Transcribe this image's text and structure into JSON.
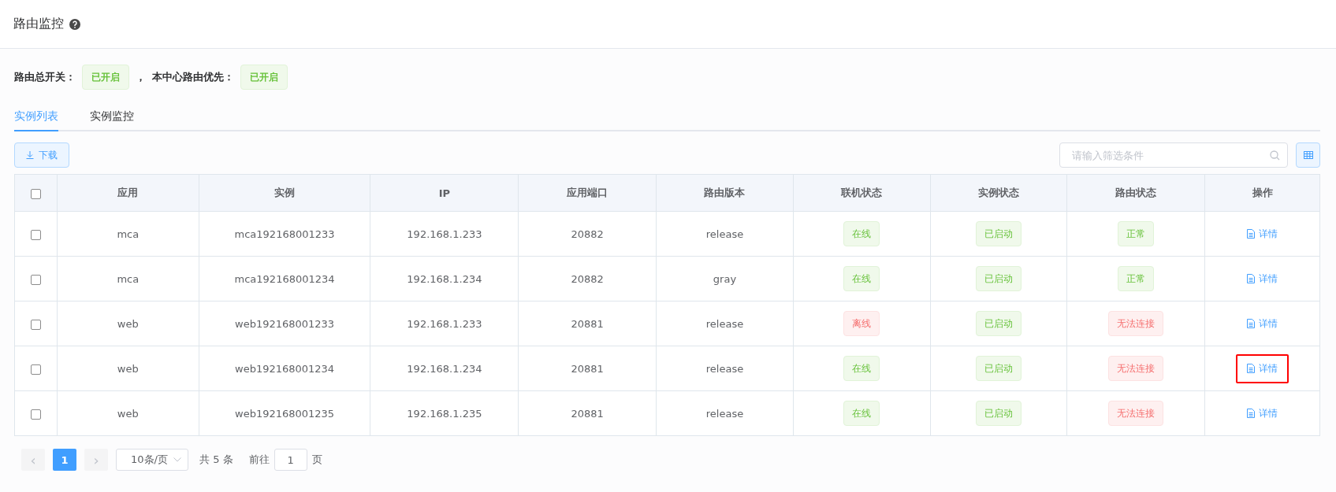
{
  "page": {
    "title": "路由监控"
  },
  "switches": [
    {
      "label": "路由总开关：",
      "value": "已开启",
      "on": true
    },
    {
      "separator": "，",
      "label": "本中心路由优先：",
      "value": "已开启",
      "on": true
    }
  ],
  "tabs": [
    {
      "label": "实例列表",
      "selected": true
    },
    {
      "label": "实例监控",
      "selected": false
    }
  ],
  "toolbar": {
    "download": "下载",
    "search": {
      "placeholder": "请输入筛选条件"
    }
  },
  "table": {
    "select_all": {
      "checked": false
    },
    "columns": [
      "应用",
      "实例",
      "IP",
      "应用端口",
      "路由版本",
      "联机状态",
      "实例状态",
      "路由状态",
      "操作"
    ],
    "rows": [
      {
        "checked": false,
        "cells": [
          "mca",
          "mca192168001233",
          "192.168.1.233",
          "20882",
          "release"
        ],
        "tags": [
          {
            "text": "在线",
            "kind": "success"
          },
          {
            "text": "已启动",
            "kind": "success"
          },
          {
            "text": "正常",
            "kind": "success"
          }
        ],
        "action": "详情",
        "highlighted": false
      },
      {
        "checked": false,
        "cells": [
          "mca",
          "mca192168001234",
          "192.168.1.234",
          "20882",
          "gray"
        ],
        "tags": [
          {
            "text": "在线",
            "kind": "success"
          },
          {
            "text": "已启动",
            "kind": "success"
          },
          {
            "text": "正常",
            "kind": "success"
          }
        ],
        "action": "详情",
        "highlighted": false
      },
      {
        "checked": false,
        "cells": [
          "web",
          "web192168001233",
          "192.168.1.233",
          "20881",
          "release"
        ],
        "tags": [
          {
            "text": "离线",
            "kind": "danger"
          },
          {
            "text": "已启动",
            "kind": "success"
          },
          {
            "text": "无法连接",
            "kind": "danger"
          }
        ],
        "action": "详情",
        "highlighted": false
      },
      {
        "checked": false,
        "cells": [
          "web",
          "web192168001234",
          "192.168.1.234",
          "20881",
          "release"
        ],
        "tags": [
          {
            "text": "在线",
            "kind": "success"
          },
          {
            "text": "已启动",
            "kind": "success"
          },
          {
            "text": "无法连接",
            "kind": "danger"
          }
        ],
        "action": "详情",
        "highlighted": true
      },
      {
        "checked": false,
        "cells": [
          "web",
          "web192168001235",
          "192.168.1.235",
          "20881",
          "release"
        ],
        "tags": [
          {
            "text": "在线",
            "kind": "success"
          },
          {
            "text": "已启动",
            "kind": "success"
          },
          {
            "text": "无法连接",
            "kind": "danger"
          }
        ],
        "action": "详情",
        "highlighted": false
      }
    ]
  },
  "pagination": {
    "prev": "‹",
    "pages": [
      {
        "label": "1",
        "selected": true
      }
    ],
    "next": "›",
    "page_size": "10条/页",
    "total": "共 5 条",
    "goto_label": "前往",
    "goto_value": "1",
    "goto_suffix": "页"
  }
}
